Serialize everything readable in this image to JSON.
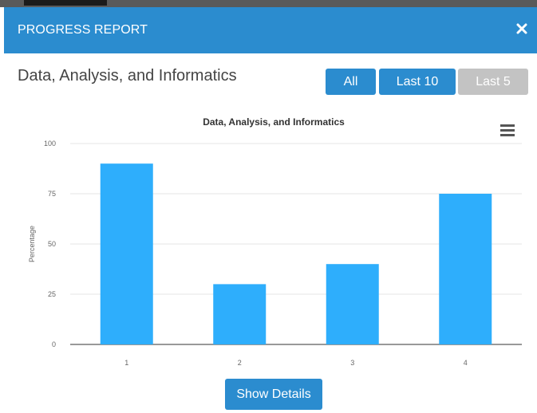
{
  "modal": {
    "title": "PROGRESS REPORT",
    "close_icon": "close-icon"
  },
  "section": {
    "title": "Data, Analysis, and Informatics"
  },
  "filters": {
    "all": "All",
    "last10": "Last 10",
    "last5": "Last 5",
    "active_color": "#2b8ccf",
    "disabled_color": "#c3c3c3"
  },
  "chart_menu_icon": "hamburger-menu-icon",
  "chart_data": {
    "type": "bar",
    "title": "Data, Analysis, and Informatics",
    "categories": [
      "1",
      "2",
      "3",
      "4"
    ],
    "values": [
      90,
      30,
      40,
      75
    ],
    "xlabel": "",
    "ylabel": "Percentage",
    "ylim": [
      0,
      100
    ],
    "yticks": [
      "0",
      "25",
      "50",
      "75",
      "100"
    ],
    "bar_color": "#2eaefc",
    "grid": true,
    "legend": "none"
  },
  "actions": {
    "show_details": "Show Details"
  }
}
